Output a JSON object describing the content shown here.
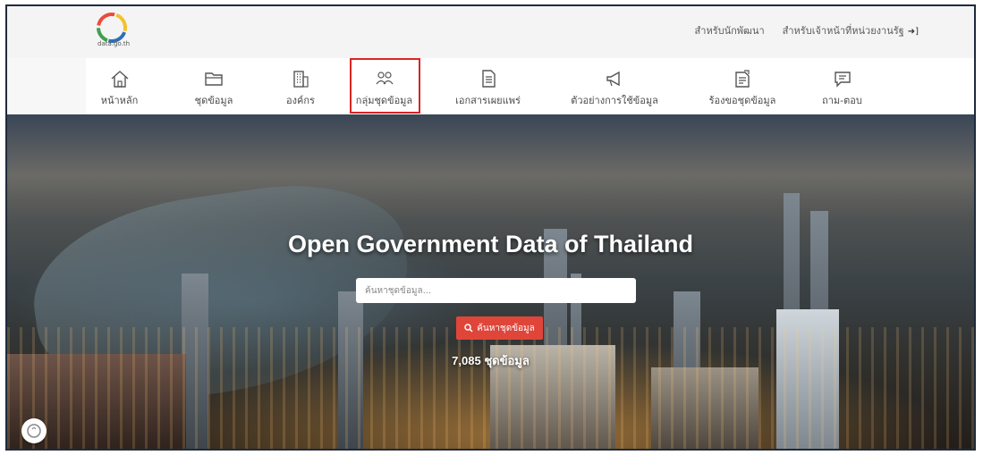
{
  "header": {
    "logo_text": "data.go.th",
    "links": [
      {
        "label": "สำหรับนักพัฒนา"
      },
      {
        "label": "สำหรับเจ้าหน้าที่หน่วยงานรัฐ"
      }
    ]
  },
  "nav": {
    "items": [
      {
        "label": "หน้าหลัก",
        "icon": "home-icon"
      },
      {
        "label": "ชุดข้อมูล",
        "icon": "folder-icon"
      },
      {
        "label": "องค์กร",
        "icon": "building-icon"
      },
      {
        "label": "กลุ่มชุดข้อมูล",
        "icon": "people-icon"
      },
      {
        "label": "เอกสารเผยแพร่",
        "icon": "document-icon"
      },
      {
        "label": "ตัวอย่างการใช้ข้อมูล",
        "icon": "megaphone-icon"
      },
      {
        "label": "ร้องขอชุดข้อมูล",
        "icon": "request-icon"
      },
      {
        "label": "ถาม-ตอบ",
        "icon": "chat-icon"
      }
    ]
  },
  "hero": {
    "title": "Open Government Data of Thailand",
    "search_placeholder": "ค้นหาชุดข้อมูล...",
    "search_button": "ค้นหาชุดข้อมูล",
    "count_text": "7,085 ชุดข้อมูล"
  },
  "colors": {
    "accent_red": "#e0453a",
    "highlight_box": "#d92525"
  }
}
